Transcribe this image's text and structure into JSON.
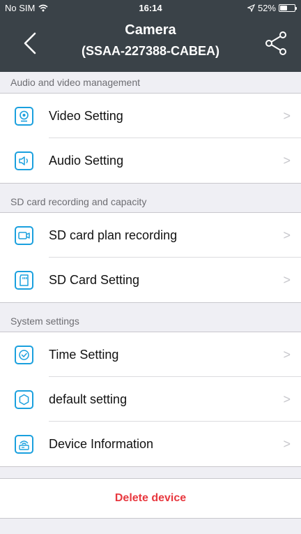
{
  "status_bar": {
    "carrier": "No SIM",
    "time": "16:14",
    "battery_text": "52%",
    "battery_level": 0.52
  },
  "nav": {
    "title": "Camera",
    "subtitle": "(SSAA-227388-CABEA)"
  },
  "sections": [
    {
      "header": "Audio and video management",
      "items": [
        {
          "label": "Video Setting",
          "icon": "video-setting-icon"
        },
        {
          "label": "Audio Setting",
          "icon": "speaker-icon"
        }
      ]
    },
    {
      "header": "SD card recording and capacity",
      "items": [
        {
          "label": "SD card plan recording",
          "icon": "camera-record-icon"
        },
        {
          "label": "SD Card Setting",
          "icon": "sd-card-icon"
        }
      ]
    },
    {
      "header": "System settings",
      "items": [
        {
          "label": "Time Setting",
          "icon": "clock-icon"
        },
        {
          "label": "default setting",
          "icon": "reset-icon"
        },
        {
          "label": "Device Information",
          "icon": "device-info-icon"
        }
      ]
    }
  ],
  "delete_label": "Delete device",
  "chevron": ">",
  "colors": {
    "nav_bg": "#3a4248",
    "accent": "#1aa0de",
    "danger": "#e8383f"
  }
}
